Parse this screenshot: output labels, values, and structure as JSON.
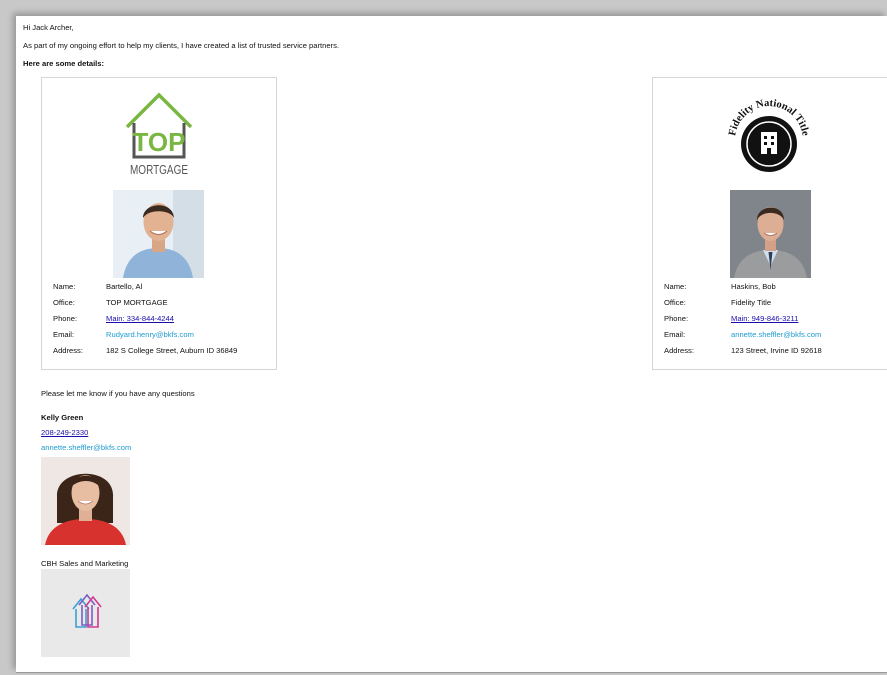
{
  "greeting": "Hi Jack Archer,",
  "intro": "As part of my ongoing effort to help my clients, I have created a list of trusted service partners.",
  "details_heading": "Here are some details:",
  "labels": {
    "name": "Name:",
    "office": "Office:",
    "phone": "Phone:",
    "email": "Email:",
    "address": "Address:"
  },
  "partners": [
    {
      "logo_text_top": "TOP",
      "logo_text_bottom": "MORTGAGE",
      "name": "Bartello, Al",
      "office": "TOP MORTGAGE",
      "phone": "Main: 334-844-4244",
      "email": "Rudyard.henry@bkfs.com",
      "address": "182 S College Street, Auburn ID 36849"
    },
    {
      "logo_text_arc": "Fidelity National Title",
      "name": "Haskins, Bob",
      "office": "Fidelity Title",
      "phone": "Main: 949-846-3211",
      "email": "annette.sheffler@bkfs.com",
      "address": "123 Street, Irvine ID 92618"
    }
  ],
  "closing": "Please let me know if you have any questions",
  "signature": {
    "name": "Kelly Green",
    "phone": "208-249-2330",
    "email": "annette.sheffler@bkfs.com",
    "company": "CBH Sales and Marketing"
  },
  "colors": {
    "link": "#1a0dab",
    "email": "#1f9bd2",
    "mortgage_green": "#7ab642",
    "mortgage_gray": "#555555"
  }
}
